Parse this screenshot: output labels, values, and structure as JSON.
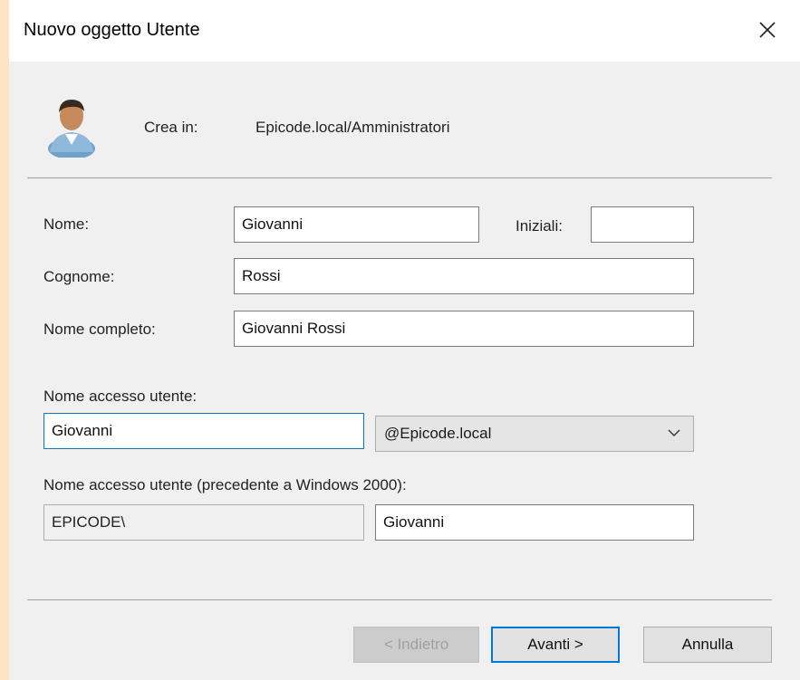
{
  "window": {
    "title": "Nuovo oggetto Utente"
  },
  "header": {
    "create_in_label": "Crea in:",
    "create_in_value": "Epicode.local/Amministratori",
    "icon": "user-icon"
  },
  "form": {
    "first_name_label": "Nome:",
    "first_name_value": "Giovanni",
    "initials_label": "Iniziali:",
    "initials_value": "",
    "last_name_label": "Cognome:",
    "last_name_value": "Rossi",
    "full_name_label": "Nome completo:",
    "full_name_value": "Giovanni Rossi",
    "logon_label": "Nome accesso utente:",
    "logon_value": "Giovanni",
    "domain_selected": "@Epicode.local",
    "pre2000_label": "Nome accesso utente (precedente a Windows 2000):",
    "pre2000_domain": "EPICODE\\",
    "pre2000_user": "Giovanni"
  },
  "buttons": {
    "back": "< Indietro",
    "next": "Avanti >",
    "cancel": "Annulla"
  },
  "colors": {
    "accent": "#0078d7",
    "background": "#f0f0f0",
    "outer": "#fde2c4"
  }
}
